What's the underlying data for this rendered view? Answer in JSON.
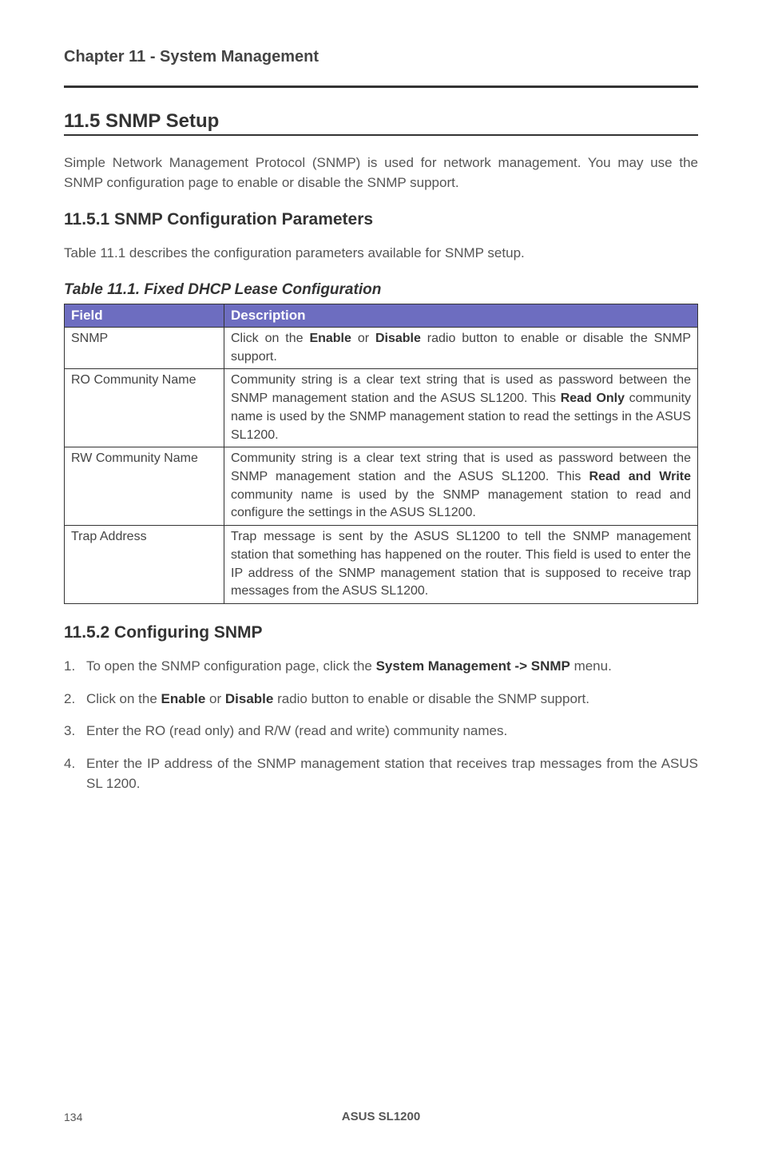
{
  "header": {
    "chapter": "Chapter 11 - System Management"
  },
  "section": {
    "title": "11.5 SNMP Setup",
    "intro": "Simple Network Management Protocol (SNMP) is used for network management. You may use the SNMP configuration page to enable or disable the SNMP support."
  },
  "sub1": {
    "title": "11.5.1 SNMP Configuration Parameters",
    "intro": "Table 11.1 describes the configuration parameters available for SNMP setup.",
    "tableCaption": "Table 11.1. Fixed DHCP Lease Configuration",
    "tableHeaders": {
      "field": "Field",
      "description": "Description"
    },
    "rows": [
      {
        "field": "SNMP",
        "desc_pre": "Click on the ",
        "desc_b1": "Enable",
        "desc_mid": " or ",
        "desc_b2": "Disable",
        "desc_post": " radio button to enable or disable the SNMP support."
      },
      {
        "field": "RO Community Name",
        "desc_pre": "Community string is a clear text string that is used as password between the SNMP management station and the ASUS SL1200. This ",
        "desc_b1": "Read Only",
        "desc_post": " community name is used by the SNMP management station to read the settings in the ASUS SL1200."
      },
      {
        "field": "RW Community Name",
        "desc_pre": "Community string is a clear text string that is used as password between the SNMP management station and the ASUS SL1200. This ",
        "desc_b1": "Read and Write",
        "desc_post": " community name is used by the SNMP management station to read and configure the settings in the ASUS SL1200."
      },
      {
        "field": "Trap Address",
        "desc_plain": "Trap message is sent by the ASUS SL1200 to tell the SNMP management station that something has happened on the router. This field is used to enter the IP address of the SNMP management station that is supposed to receive trap messages from the ASUS SL1200."
      }
    ]
  },
  "sub2": {
    "title": "11.5.2 Configuring SNMP",
    "steps": [
      {
        "pre": "To open the SNMP configuration page, click the ",
        "b1": "System Management -> SNMP",
        "post": " menu."
      },
      {
        "pre": "Click on the ",
        "b1": "Enable",
        "mid": " or ",
        "b2": "Disable",
        "post": " radio button to enable or disable the SNMP support."
      },
      {
        "plain": "Enter the RO (read only) and R/W (read and write) community names."
      },
      {
        "plain": "Enter the IP address of the SNMP management station that receives trap messages from the ASUS SL 1200."
      }
    ]
  },
  "footer": {
    "page": "134",
    "product": "ASUS SL1200"
  }
}
